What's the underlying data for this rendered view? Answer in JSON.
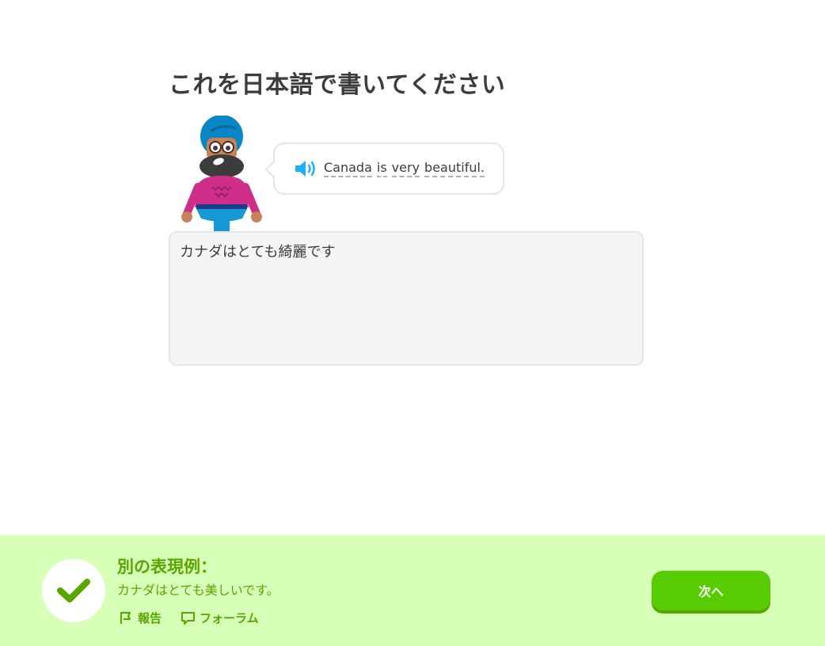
{
  "challenge": {
    "title": "これを日本語で書いてください",
    "sentence_words": [
      "Canada",
      "is",
      "very",
      "beautiful."
    ],
    "answer_value": "カナダはとても綺麗です"
  },
  "feedback": {
    "status": "correct",
    "heading": "別の表現例：",
    "alternative": "カナダはとても美しいです。",
    "report_label": "報告",
    "forum_label": "フォーラム",
    "next_label": "次へ",
    "colors": {
      "background": "#d7ffb8",
      "text": "#58a700",
      "button": "#58cc02",
      "speaker": "#1cb0f6"
    }
  },
  "icons": {
    "speaker": "speaker-icon",
    "check": "checkmark-icon",
    "report": "flag-icon",
    "forum": "speech-bubble-icon"
  }
}
